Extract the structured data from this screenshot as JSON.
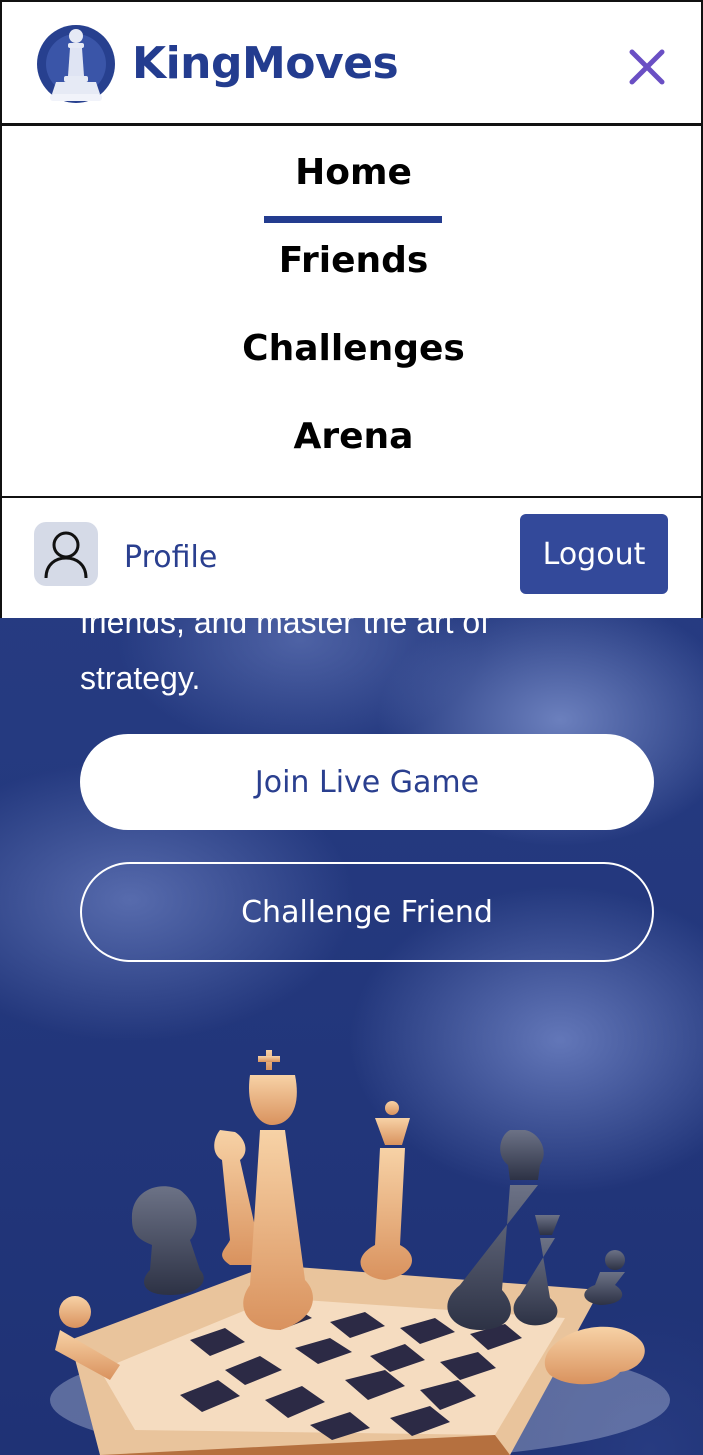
{
  "header": {
    "brand": "KingMoves",
    "close_icon": "close-icon",
    "logo_icon": "pawn-logo-icon"
  },
  "menu": {
    "items": [
      {
        "label": "Home",
        "active": true
      },
      {
        "label": "Friends",
        "active": false
      },
      {
        "label": "Challenges",
        "active": false
      },
      {
        "label": "Arena",
        "active": false
      }
    ]
  },
  "profile_bar": {
    "profile_label": "Profile",
    "logout_label": "Logout",
    "avatar_icon": "user-icon"
  },
  "hero": {
    "description_partial": "friends, and master the art of",
    "description_end": "strategy.",
    "join_button": "Join Live Game",
    "challenge_button": "Challenge Friend"
  },
  "colors": {
    "brand": "#233c8f",
    "accent_button": "#33499a",
    "close_icon": "#6a4fc4",
    "hero_bg": "#22357a"
  }
}
